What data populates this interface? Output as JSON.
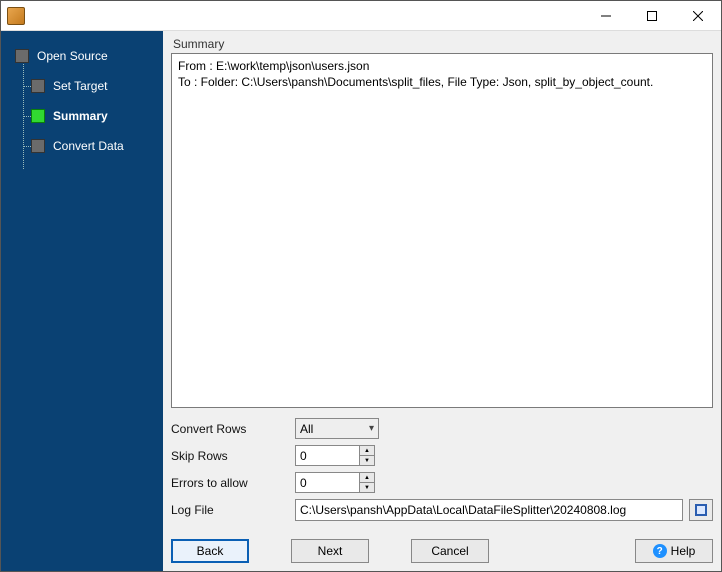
{
  "titlebar": {
    "title": ""
  },
  "sidebar": {
    "steps": [
      {
        "label": "Open Source",
        "active": false
      },
      {
        "label": "Set Target",
        "active": false
      },
      {
        "label": "Summary",
        "active": true
      },
      {
        "label": "Convert Data",
        "active": false
      }
    ]
  },
  "summary": {
    "group_label": "Summary",
    "from_line": "From : E:\\work\\temp\\json\\users.json",
    "to_line": "To : Folder: C:\\Users\\pansh\\Documents\\split_files, File Type: Json, split_by_object_count."
  },
  "form": {
    "convert_rows": {
      "label": "Convert Rows",
      "value": "All"
    },
    "skip_rows": {
      "label": "Skip Rows",
      "value": "0"
    },
    "errors_to_allow": {
      "label": "Errors to allow",
      "value": "0"
    },
    "log_file": {
      "label": "Log File",
      "value": "C:\\Users\\pansh\\AppData\\Local\\DataFileSplitter\\20240808.log"
    }
  },
  "buttons": {
    "back": "Back",
    "next": "Next",
    "cancel": "Cancel",
    "help": "Help"
  }
}
